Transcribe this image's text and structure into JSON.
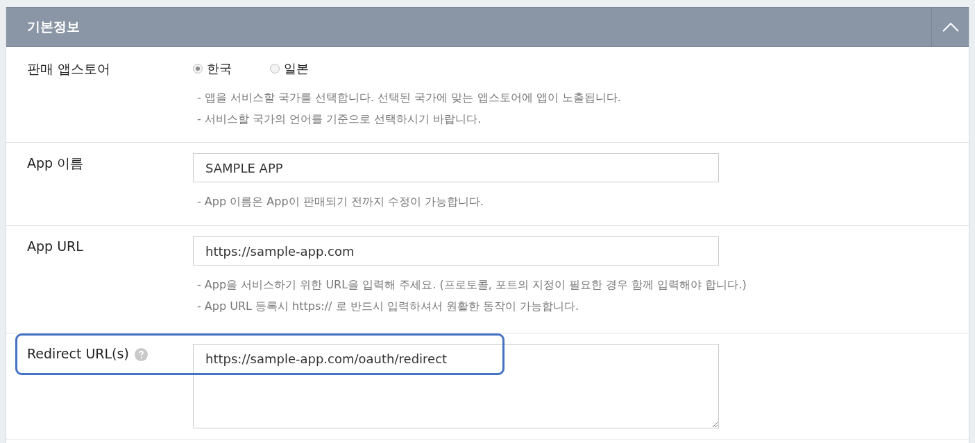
{
  "panel": {
    "title": "기본정보",
    "expanded": true
  },
  "rows": [
    {
      "kind": "radio",
      "label": "판매 앱스토어",
      "options": [
        {
          "label": "한국",
          "selected": true
        },
        {
          "label": "일본",
          "selected": false
        }
      ],
      "hints": [
        "-  앱을 서비스할 국가를 선택합니다. 선택된 국가에 맞는 앱스토어에 앱이 노출됩니다.",
        "-  서비스할 국가의 언어를 기준으로 선택하시기 바랍니다."
      ]
    },
    {
      "kind": "input",
      "label": "App 이름",
      "value": "SAMPLE APP",
      "hints": [
        "-  App 이름은 App이 판매되기 전까지 수정이 가능합니다."
      ]
    },
    {
      "kind": "input",
      "label": "App URL",
      "value": "https://sample-app.com",
      "hints": [
        "-  App을 서비스하기 위한 URL을 입력해 주세요. (프로토콜, 포트의 지정이 필요한 경우 함께 입력해야 합니다.)",
        "-  App URL 등록시 https:// 로 반드시 입력하셔서 원활한 동작이 가능합니다."
      ]
    },
    {
      "kind": "textarea",
      "label": "Redirect URL(s)",
      "help": true,
      "highlighted": true,
      "value": "https://sample-app.com/oauth/redirect"
    }
  ]
}
